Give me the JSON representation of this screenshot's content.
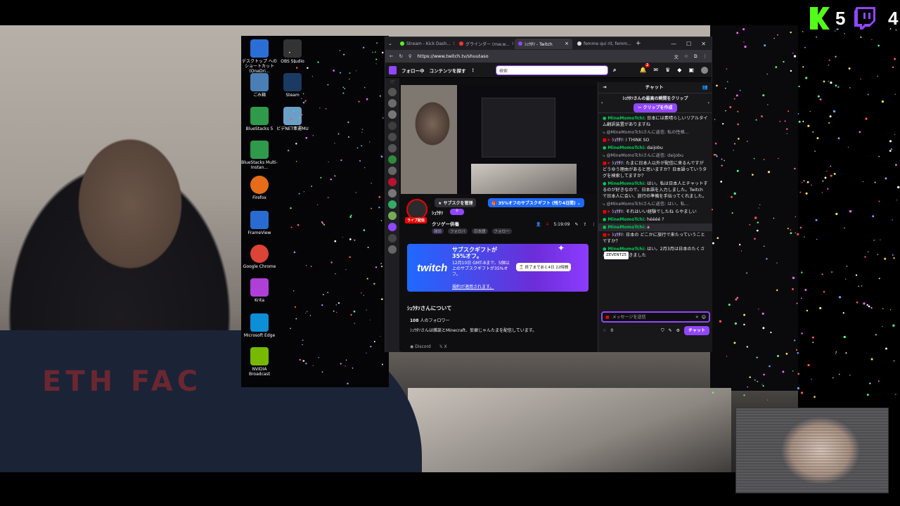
{
  "overlay": {
    "kick_count": "5",
    "twitch_count": "4"
  },
  "desktop_icons": [
    {
      "label": "デスクトップ へのショートカット (OneDri...",
      "icon": "onedrive-shortcut-icon"
    },
    {
      "label": "OBS Studio",
      "icon": "obs-studio-icon"
    },
    {
      "label": "ごみ箱",
      "icon": "recycle-bin-icon"
    },
    {
      "label": "Steam",
      "icon": "steam-icon"
    },
    {
      "label": "BlueStacks 5",
      "icon": "bluestacks-icon"
    },
    {
      "label": "ビデNET牽運MU",
      "icon": "app-icon"
    },
    {
      "label": "BlueStacks Multi-Instan...",
      "icon": "bluestacks-multi-icon"
    },
    {
      "label": "Firefox",
      "icon": "firefox-icon"
    },
    {
      "label": "FrameView",
      "icon": "frameview-icon"
    },
    {
      "label": "Google Chrome",
      "icon": "chrome-icon"
    },
    {
      "label": "Krita",
      "icon": "krita-icon"
    },
    {
      "label": "Microsoft Edge",
      "icon": "edge-icon"
    },
    {
      "label": "NVIDIA Broadcast",
      "icon": "nvidia-broadcast-icon"
    }
  ],
  "browser": {
    "tabs": [
      {
        "label": "Stream - Kick Dash...",
        "color": "#53fc18",
        "active": false
      },
      {
        "label": "グラインダー (mw.w...",
        "color": "#ff3333",
        "active": false
      },
      {
        "label": "ｼｭｳﾀｿ - Twitch",
        "color": "#9146ff",
        "active": true
      },
      {
        "label": "femme qui rit, femm...",
        "color": "#dddddd",
        "active": false
      }
    ],
    "url": "https://www.twitch.tv/shuutaso"
  },
  "twitch": {
    "nav_following": "フォロー中",
    "nav_browse": "コンテンツを探す",
    "search_placeholder": "検索",
    "notif_badge": "2",
    "channel": {
      "live_badge": "ライブ配信",
      "display_name": "ｼｭｳﾀｿ",
      "title": "クソゲー供養",
      "tags": [
        "雑談",
        "フォロバ",
        "日本語",
        "フォロー"
      ],
      "manage_sub": "サブスクを管理",
      "sub_offer": "35%オフのサブスクギフト (残り4日間)",
      "viewers": "4",
      "uptime": "5:19:09",
      "gift_title": "サブスクギフトが35%オフ。",
      "gift_body": "12月10日 GMT-8まで、5個以上のサブスクギフトが35%オフ。",
      "gift_link": "規約が適用されます。",
      "gift_timer": "終了まであと4日 22時間",
      "about_heading": "ｼｭｳﾀｿさんについて",
      "followers": "108",
      "followers_label": "人のフォロワー",
      "about_text": "ｼｭｳﾀｿさんは雑談とMinecraft、妄癖じゃんたまを配信しています。",
      "link_discord": "Discord",
      "link_x": "X"
    },
    "chat": {
      "header": "チャット",
      "clip_title": "ｼｭｳﾀｿさんの最高の瞬間をクリップ",
      "clip_button": "クリップを作成",
      "messages": [
        {
          "user": "MineMomoTchi",
          "text": ": 日本には素晴らしいリアルタイム翻訳装置がありますね",
          "kind": "green"
        },
        {
          "user": "",
          "text": "@MineMomoTchiさんに返信: 私の性格...",
          "kind": "reply"
        },
        {
          "user": "ｼｭｳﾀｿ",
          "text": ": I THINK SO",
          "kind": "streamer"
        },
        {
          "user": "MineMomoTchi",
          "text": ": daijobu",
          "kind": "green"
        },
        {
          "user": "",
          "text": "@MineMomoTchiさんに返信: daijobu",
          "kind": "reply"
        },
        {
          "user": "ｼｭｳﾀｿ",
          "text": ": たまに日本人以外が配信に来るんですが どうゆう理由があると思いますか？日本語っていうタグを検索してますか？",
          "kind": "streamer"
        },
        {
          "user": "MineMomoTchi",
          "text": ": はい。私は日本人とチャットするのが好きなので、日本語を入力しました。Twitch で日本人に会い、旅行の準備を手伝ってくれました。",
          "kind": "green"
        },
        {
          "user": "",
          "text": "@MineMomoTchiさんに返信: はい。私...",
          "kind": "reply"
        },
        {
          "user": "ｼｭｳﾀｿ",
          "text": ": それはいい経験でしたね らやましい",
          "kind": "streamer"
        },
        {
          "user": "MineMomoTchi",
          "text": ": héééé ?",
          "kind": "green"
        },
        {
          "user": "MineMomoTchi",
          "text": ": a",
          "kind": "green"
        },
        {
          "user": "ｼｭｳﾀｿ",
          "text": ": 日本の どこかに旅行で来たっていうことですか？",
          "kind": "streamer"
        },
        {
          "user": "MineMomoTchi",
          "text": ": はい。2月3月は日本のたくさんの場所に行きました",
          "kind": "green"
        }
      ],
      "tooltip": "ZEVENT25",
      "input_placeholder": "メッセージを送信",
      "points": "0",
      "send_button": "チャット"
    }
  },
  "colors": {
    "twitch_purple": "#9146ff",
    "kick_green": "#53fc18"
  }
}
